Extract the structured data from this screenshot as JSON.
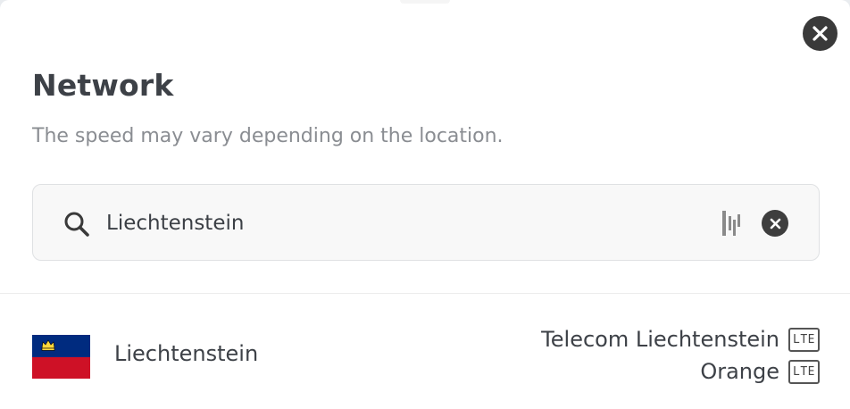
{
  "header": {
    "title": "Network",
    "subtitle": "The speed may vary depending on the location."
  },
  "search": {
    "value": "Liechtenstein",
    "placeholder": ""
  },
  "results": [
    {
      "country": "Liechtenstein",
      "flag_colors": [
        "#002b7f",
        "#ce1126"
      ],
      "networks": [
        {
          "name": "Telecom Liechtenstein",
          "badge": "LTE"
        },
        {
          "name": "Orange",
          "badge": "LTE"
        }
      ]
    }
  ],
  "icons": {
    "close": "close-icon",
    "search": "search-icon",
    "barcode": "barcode-icon",
    "clear": "clear-icon"
  }
}
